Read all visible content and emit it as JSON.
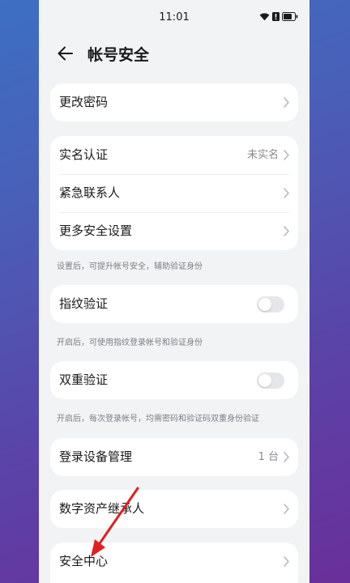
{
  "status_bar": {
    "time": "11:01",
    "icons": [
      "wifi-icon",
      "alert-icon",
      "battery-icon"
    ]
  },
  "header": {
    "back_icon": "arrow-left-icon",
    "title": "帐号安全"
  },
  "items": {
    "change_password": {
      "label": "更改密码"
    },
    "real_name": {
      "label": "实名认证",
      "value": "未实名"
    },
    "emergency_contact": {
      "label": "紧急联系人"
    },
    "more_security": {
      "label": "更多安全设置"
    },
    "security_hint": "设置后，可提升帐号安全，辅助验证身份",
    "fingerprint": {
      "label": "指纹验证",
      "enabled": false
    },
    "fingerprint_hint": "开启后，可使用指纹登录帐号和验证身份",
    "two_factor": {
      "label": "双重验证",
      "enabled": false
    },
    "two_factor_hint": "开启后，每次登录帐号，均需密码和验证码双重身份验证",
    "device_management": {
      "label": "登录设备管理",
      "value": "1 台"
    },
    "digital_heir": {
      "label": "数字资产继承人"
    },
    "security_center": {
      "label": "安全中心"
    }
  },
  "colors": {
    "background_gradient_start": "#3d6fc2",
    "background_gradient_end": "#6a2f9a",
    "screen_bg": "#f1f3f5",
    "card_bg": "#ffffff",
    "annotation_arrow": "#e02020"
  }
}
